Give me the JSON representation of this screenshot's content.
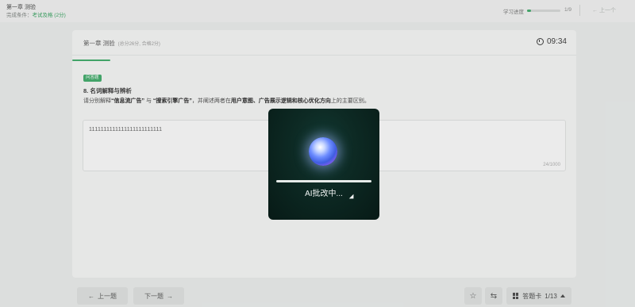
{
  "header": {
    "course_title": "第一章 测验",
    "completion_label": "完成条件：",
    "completion_value": "考试及格 (2分)",
    "progress_label": "学习进度",
    "progress_fraction": 0.11,
    "progress_count": "1/9",
    "prev_label": "上一个"
  },
  "quiz": {
    "title": "第一章 测验",
    "meta": "(总分26分, 合格2分)",
    "timer": "09:34"
  },
  "question": {
    "badge": "问答题",
    "title": "8. 名词解释与辨析",
    "text_prefix": "请分别解释",
    "term1": "“信息流广告”",
    "text_and": "与",
    "term2": "“搜索引擎广告”",
    "text_mid": "，并阐述两者在",
    "focus": "用户意图、广告展示逻辑和核心优化方向",
    "text_suffix": "上的主要区别。"
  },
  "answer": {
    "value": "1111111111111111111111111",
    "count": "24/1000"
  },
  "nav": {
    "prev_label": "上一题",
    "next_label": "下一题",
    "answer_sheet_label": "答题卡",
    "answer_sheet_count": "1/13"
  },
  "modal": {
    "status": "AI批改中..."
  },
  "icons": {
    "arrow_left": "←",
    "arrow_right": "→",
    "star": "☆",
    "filter": "⇆"
  },
  "colors": {
    "accent": "#3aa865",
    "modal_bg": "#0d2a24"
  }
}
